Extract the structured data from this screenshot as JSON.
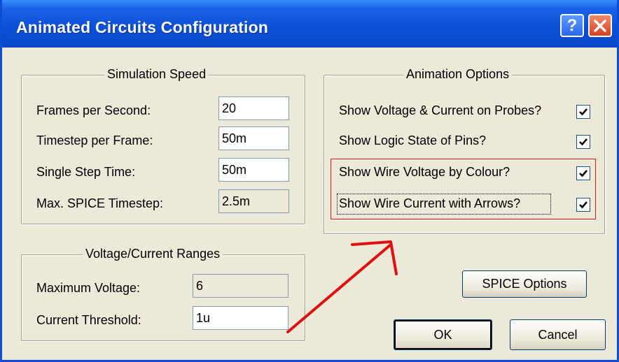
{
  "window": {
    "title": "Animated Circuits Configuration"
  },
  "titlebar": {
    "help_label": "?"
  },
  "simulation_speed": {
    "legend": "Simulation Speed",
    "rows": [
      {
        "label": "Frames per Second:",
        "value": "20"
      },
      {
        "label": "Timestep per Frame:",
        "value": "50m"
      },
      {
        "label": "Single Step Time:",
        "value": "50m"
      },
      {
        "label": "Max. SPICE Timestep:",
        "value": "2.5m"
      }
    ]
  },
  "animation_options": {
    "legend": "Animation Options",
    "items": [
      {
        "label": "Show Voltage & Current on Probes?",
        "checked": true
      },
      {
        "label": "Show Logic State of Pins?",
        "checked": true
      },
      {
        "label": "Show Wire Voltage by Colour?",
        "checked": true
      },
      {
        "label": "Show Wire Current with Arrows?",
        "checked": true
      }
    ]
  },
  "ranges": {
    "legend": "Voltage/Current Ranges",
    "rows": [
      {
        "label": "Maximum Voltage:",
        "value": "6"
      },
      {
        "label": "Current Threshold:",
        "value": "1u"
      }
    ]
  },
  "buttons": {
    "spice": "SPICE Options",
    "ok": "OK",
    "cancel": "Cancel"
  },
  "colors": {
    "titlebar": "#0a4fd6",
    "face": "#ece9d8",
    "highlight": "#e01818"
  }
}
